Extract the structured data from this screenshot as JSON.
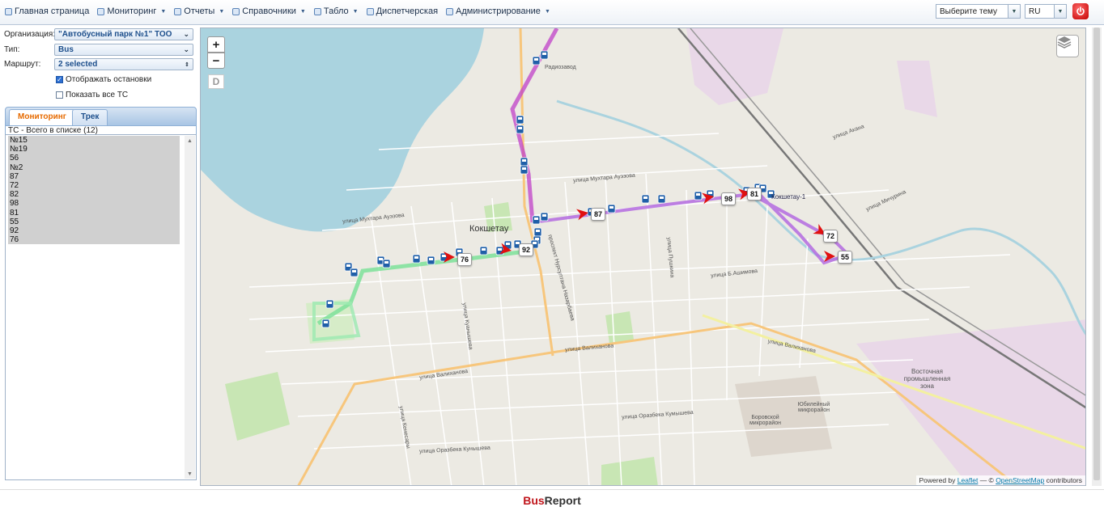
{
  "menu": {
    "items": [
      {
        "label": "Главная страница",
        "icon": "home-icon",
        "has_caret": false
      },
      {
        "label": "Мониторинг",
        "icon": "search-icon",
        "has_caret": true
      },
      {
        "label": "Отчеты",
        "icon": "report-icon",
        "has_caret": true
      },
      {
        "label": "Справочники",
        "icon": "document-icon",
        "has_caret": true
      },
      {
        "label": "Табло",
        "icon": "board-icon",
        "has_caret": true
      },
      {
        "label": "Диспетчерская",
        "icon": "dispatch-icon",
        "has_caret": false
      },
      {
        "label": "Администрирование",
        "icon": "gear-icon",
        "has_caret": true
      }
    ],
    "theme_placeholder": "Выберите тему",
    "language": "RU"
  },
  "filters": {
    "organization_label": "Организация:",
    "organization_value": "\"Автобусный парк №1\" ТОО",
    "type_label": "Тип:",
    "type_value": "Bus",
    "route_label": "Маршрут:",
    "route_value": "2 selected",
    "show_stops_label": "Отображать остановки",
    "show_stops_checked": true,
    "show_all_label": "Показать все ТС",
    "show_all_checked": false
  },
  "tabs": {
    "monitoring": "Мониторинг",
    "track": "Трек",
    "active": "monitoring"
  },
  "vehicle_list": {
    "header": "ТС - Всего в списке (12)",
    "items": [
      "№15",
      "№19",
      "56",
      "№2",
      "87",
      "72",
      "82",
      "98",
      "81",
      "55",
      "92",
      "76"
    ]
  },
  "map": {
    "zoom_in": "+",
    "zoom_out": "−",
    "draw_tool": "D",
    "city_label": "Кокшетау",
    "attribution_prefix": "Powered by",
    "attribution_leaflet": "Leaflet",
    "attribution_mid": "— ©",
    "attribution_osm": "OpenStreetMap",
    "attribution_suffix": "contributors",
    "street_labels": [
      "улица Мухтара Ауэзова",
      "улица Мухтара Ауэзова",
      "улица Валиханова",
      "улица Валиханова",
      "улица Валиханова",
      "улица Оразбека Кумышева",
      "улица Оразбека Кунышева",
      "улица Б.Ашимова",
      "проспект Нурсултана Назарбаева",
      "улица Акана",
      "улица Мичурина",
      "улица Кенесары",
      "улица Куанышева",
      "улица Пушкина",
      "Восточная промышленная зона",
      "Юбилейный микрорайон",
      "Боровской микрорайон",
      "Радиозавод",
      "Кокшетау-1"
    ],
    "bus_badges": [
      "76",
      "92",
      "87",
      "98",
      "81",
      "72",
      "55"
    ],
    "route_colors": {
      "green": "#7ee29a",
      "purple": "#b46be0",
      "magenta": "#c040c8",
      "bus_icon": "#1f5fa8",
      "arrow": "#e01010"
    }
  },
  "footer": {
    "brand_part1": "Bus",
    "brand_part2": "Report"
  }
}
